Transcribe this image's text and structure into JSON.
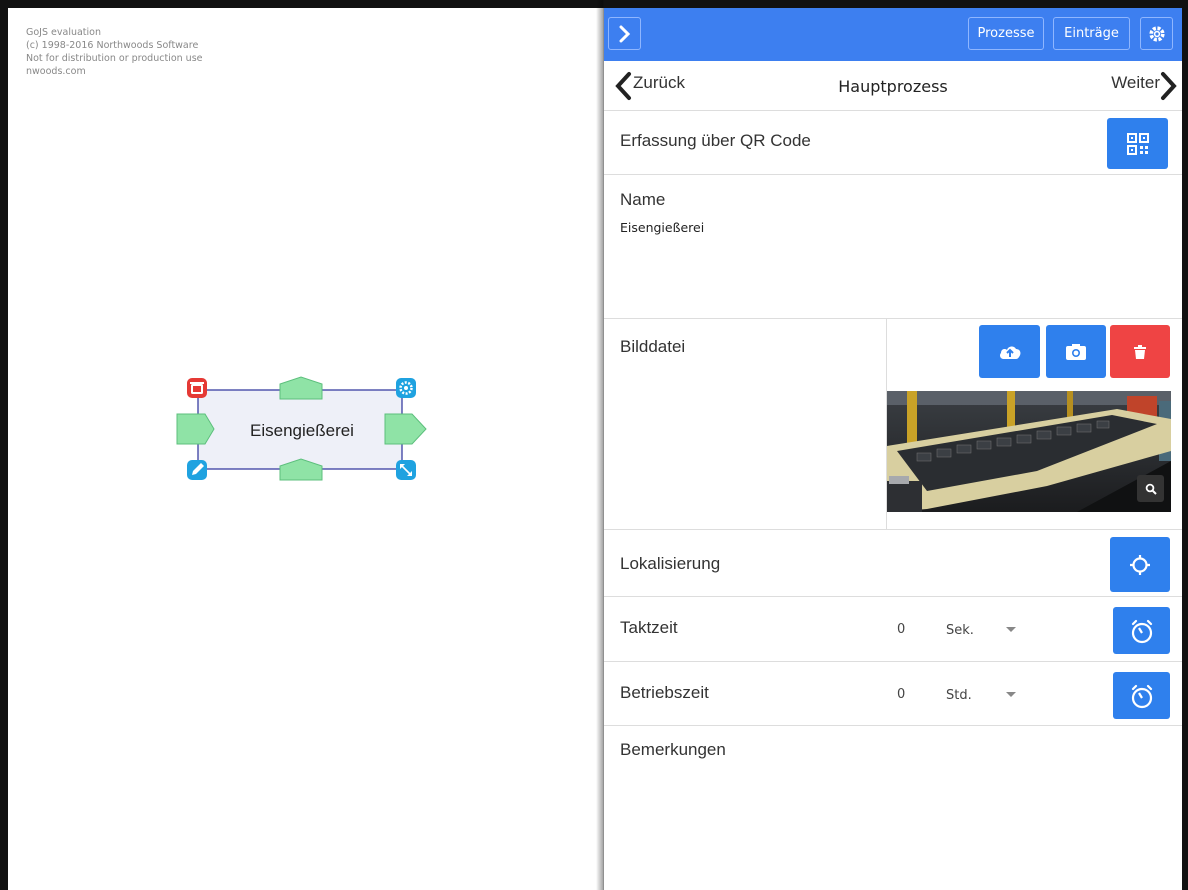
{
  "watermark": {
    "line1": "GoJS evaluation",
    "line2": "(c) 1998-2016 Northwoods Software",
    "line3": "Not for distribution or production use",
    "line4": "nwoods.com"
  },
  "diagram": {
    "node_label": "Eisengießerei",
    "colors": {
      "node_fill": "#eef0f8",
      "node_border": "#2a2f9a",
      "port_fill": "#8fe3a6",
      "port_stroke": "#5cbf7c",
      "delete_handle": "#e53935",
      "gear_handle": "#1fa2e0",
      "edit_handle": "#1fa2e0",
      "resize_handle": "#1fa2e0"
    }
  },
  "toolbar": {
    "toggle_icon": "chevron-right-icon",
    "prozesse_label": "Prozesse",
    "eintraege_label": "Einträge",
    "settings_icon": "gear-icon",
    "color": "#3d7ff0"
  },
  "nav": {
    "back_label": "Zurück",
    "title": "Hauptprozess",
    "next_label": "Weiter"
  },
  "form": {
    "qr_label": "Erfassung über QR Code",
    "name_label": "Name",
    "name_value": "Eisengießerei",
    "image_label": "Bilddatei",
    "location_label": "Lokalisierung",
    "takt_label": "Taktzeit",
    "takt_value": "0",
    "takt_unit": "Sek.",
    "betrieb_label": "Betriebszeit",
    "betrieb_value": "0",
    "betrieb_unit": "Std.",
    "notes_label": "Bemerkungen"
  }
}
